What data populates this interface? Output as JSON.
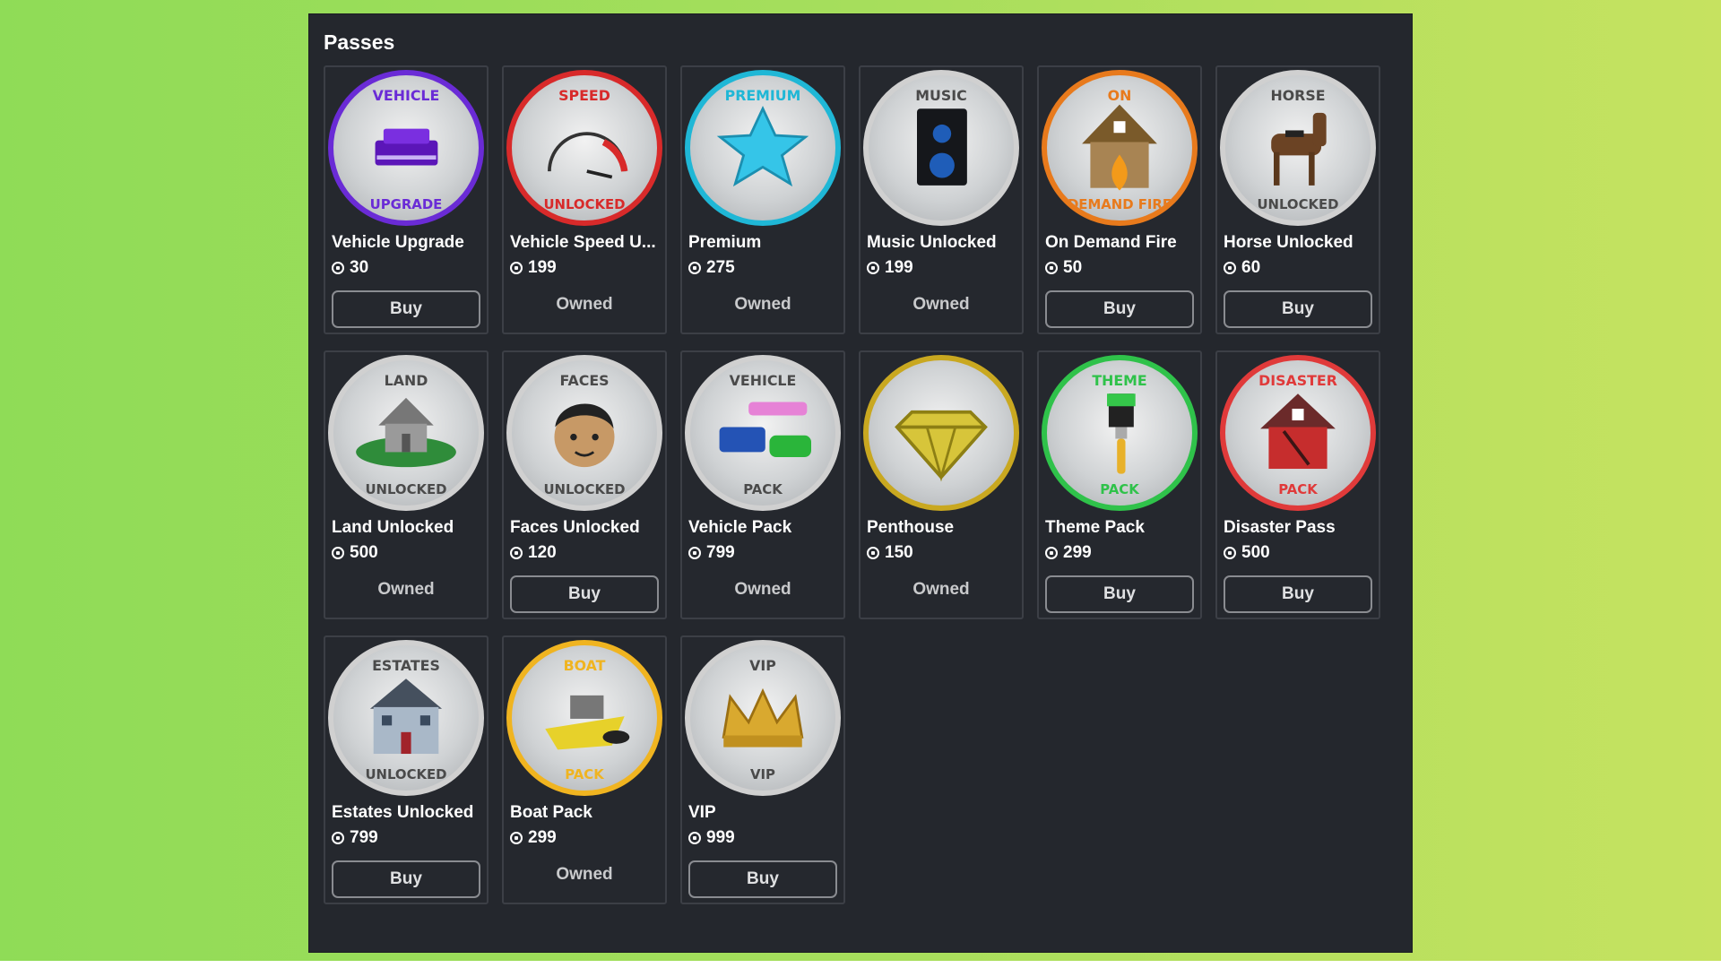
{
  "panel": {
    "title": "Passes"
  },
  "buy_label": "Buy",
  "owned_label": "Owned",
  "passes": [
    {
      "name": "Vehicle Upgrade",
      "price": "30",
      "status": "buy",
      "badge_top": "VEHICLE",
      "badge_bottom": "UPGRADE",
      "ring": "#6a2bd6",
      "icon": "car-icon"
    },
    {
      "name": "Vehicle Speed U...",
      "price": "199",
      "status": "owned",
      "badge_top": "SPEED",
      "badge_bottom": "UNLOCKED",
      "ring": "#d82a2a",
      "icon": "speedometer-icon"
    },
    {
      "name": "Premium",
      "price": "275",
      "status": "owned",
      "badge_top": "PREMIUM",
      "badge_bottom": "",
      "ring": "#1fb7d6",
      "icon": "star-icon"
    },
    {
      "name": "Music Unlocked",
      "price": "199",
      "status": "owned",
      "badge_top": "MUSIC",
      "badge_bottom": "",
      "ring": "#d0d0d0",
      "icon": "speaker-icon"
    },
    {
      "name": "On Demand Fire",
      "price": "50",
      "status": "buy",
      "badge_top": "ON",
      "badge_bottom": "DEMAND FIRE",
      "ring": "#e87a1c",
      "icon": "house-fire-icon"
    },
    {
      "name": "Horse Unlocked",
      "price": "60",
      "status": "buy",
      "badge_top": "HORSE",
      "badge_bottom": "UNLOCKED",
      "ring": "#d0d0d0",
      "icon": "horse-icon"
    },
    {
      "name": "Land Unlocked",
      "price": "500",
      "status": "owned",
      "badge_top": "LAND",
      "badge_bottom": "UNLOCKED",
      "ring": "#d0d0d0",
      "icon": "land-icon"
    },
    {
      "name": "Faces Unlocked",
      "price": "120",
      "status": "buy",
      "badge_top": "FACES",
      "badge_bottom": "UNLOCKED",
      "ring": "#d0d0d0",
      "icon": "face-icon"
    },
    {
      "name": "Vehicle Pack",
      "price": "799",
      "status": "owned",
      "badge_top": "VEHICLE",
      "badge_bottom": "PACK",
      "ring": "#d0d0d0",
      "icon": "vehicles-icon"
    },
    {
      "name": "Penthouse",
      "price": "150",
      "status": "owned",
      "badge_top": "",
      "badge_bottom": "",
      "ring": "#c9a820",
      "icon": "diamond-icon"
    },
    {
      "name": "Theme Pack",
      "price": "299",
      "status": "buy",
      "badge_top": "THEME",
      "badge_bottom": "PACK",
      "ring": "#2fc24a",
      "icon": "paintbrush-icon"
    },
    {
      "name": "Disaster Pass",
      "price": "500",
      "status": "buy",
      "badge_top": "DISASTER",
      "badge_bottom": "PACK",
      "ring": "#e03a3a",
      "icon": "broken-house-icon"
    },
    {
      "name": "Estates Unlocked",
      "price": "799",
      "status": "buy",
      "badge_top": "ESTATES",
      "badge_bottom": "UNLOCKED",
      "ring": "#d0d0d0",
      "icon": "mansion-icon"
    },
    {
      "name": "Boat Pack",
      "price": "299",
      "status": "owned",
      "badge_top": "BOAT",
      "badge_bottom": "PACK",
      "ring": "#f0b420",
      "icon": "boat-icon"
    },
    {
      "name": "VIP",
      "price": "999",
      "status": "buy",
      "badge_top": "VIP",
      "badge_bottom": "VIP",
      "ring": "#d0d0d0",
      "icon": "crown-icon"
    }
  ],
  "colors": {
    "panel_bg": "#24272d",
    "card_border": "#3c3f46",
    "button_border": "#8a8c91",
    "text": "#ffffff"
  }
}
